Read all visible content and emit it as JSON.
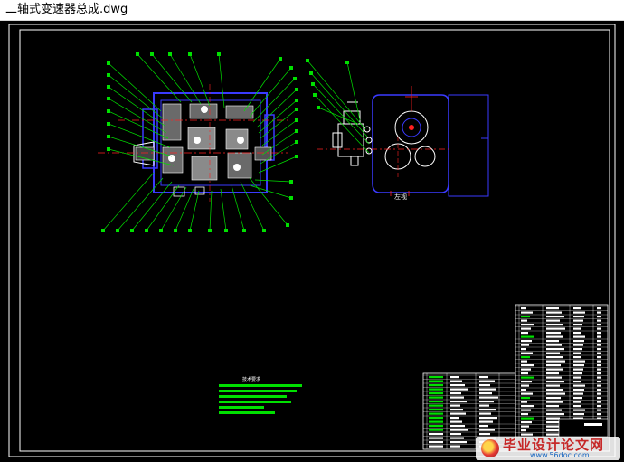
{
  "window": {
    "title": "二轴式变速器总成.dwg"
  },
  "drawing": {
    "view_label": "左视",
    "notes_title": "技术要求",
    "colors": {
      "background": "#000000",
      "frame": "#ffffff",
      "part_outline": "#3a3aff",
      "leader": "#00e000",
      "centerline": "#ff2020",
      "hatch": "#ffffff",
      "text_white": "#ffffff"
    }
  },
  "watermark": {
    "title": "毕业设计论文网",
    "url": "www.56doc.com"
  }
}
